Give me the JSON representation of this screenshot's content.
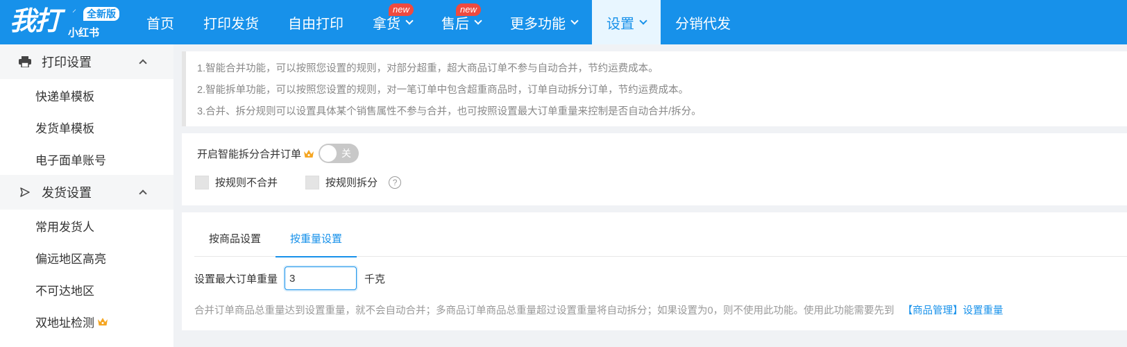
{
  "brand": {
    "name": "我打",
    "edition_badge": "全新版",
    "sub": "小红书"
  },
  "colors": {
    "primary": "#1791ea",
    "badge_red": "#ef4a3f",
    "active_nav_bg": "#e8f6ff",
    "crown": "#f5a623"
  },
  "nav": {
    "items": [
      {
        "label": "首页"
      },
      {
        "label": "打印发货"
      },
      {
        "label": "自由打印"
      },
      {
        "label": "拿货",
        "badge": "new"
      },
      {
        "label": "售后",
        "badge": "new"
      },
      {
        "label": "更多功能"
      },
      {
        "label": "设置"
      },
      {
        "label": "分销代发"
      }
    ],
    "active": "设置"
  },
  "sidebar": {
    "groups": [
      {
        "label": "打印设置",
        "icon": "printer-icon",
        "items": [
          {
            "label": "快递单模板"
          },
          {
            "label": "发货单模板"
          },
          {
            "label": "电子面单账号"
          }
        ]
      },
      {
        "label": "发货设置",
        "icon": "send-icon",
        "items": [
          {
            "label": "常用发货人"
          },
          {
            "label": "偏远地区高亮"
          },
          {
            "label": "不可达地区"
          },
          {
            "label": "双地址检测",
            "crown": true
          }
        ]
      }
    ]
  },
  "notice": {
    "lines": [
      "1.智能合并功能，可以按照您设置的规则，对部分超重，超大商品订单不参与自动合并，节约运费成本。",
      "2.智能拆单功能，可以按照您设置的规则，对一笔订单中包含超重商品时，订单自动拆分订单，节约运费成本。",
      "3.合并、拆分规则可以设置具体某个销售属性不参与合并，也可按照设置最大订单重量来控制是否自动合并/拆分。"
    ]
  },
  "smart_split": {
    "label": "开启智能拆分合并订单",
    "toggle_text": "关",
    "toggle_on": false,
    "options": [
      {
        "label": "按规则不合并",
        "checked": false
      },
      {
        "label": "按规则拆分",
        "checked": false
      }
    ],
    "help_glyph": "?"
  },
  "tabs": {
    "items": [
      {
        "label": "按商品设置"
      },
      {
        "label": "按重量设置"
      }
    ],
    "active": "按重量设置"
  },
  "weight": {
    "label": "设置最大订单重量",
    "value": "3",
    "unit": "千克",
    "hint": "合并订单商品总重量达到设置重量，就不会自动合并；多商品订单商品总重量超过设置重量将自动拆分；如果设置为0，则不使用此功能。使用此功能需要先到",
    "link": "【商品管理】设置重量"
  }
}
